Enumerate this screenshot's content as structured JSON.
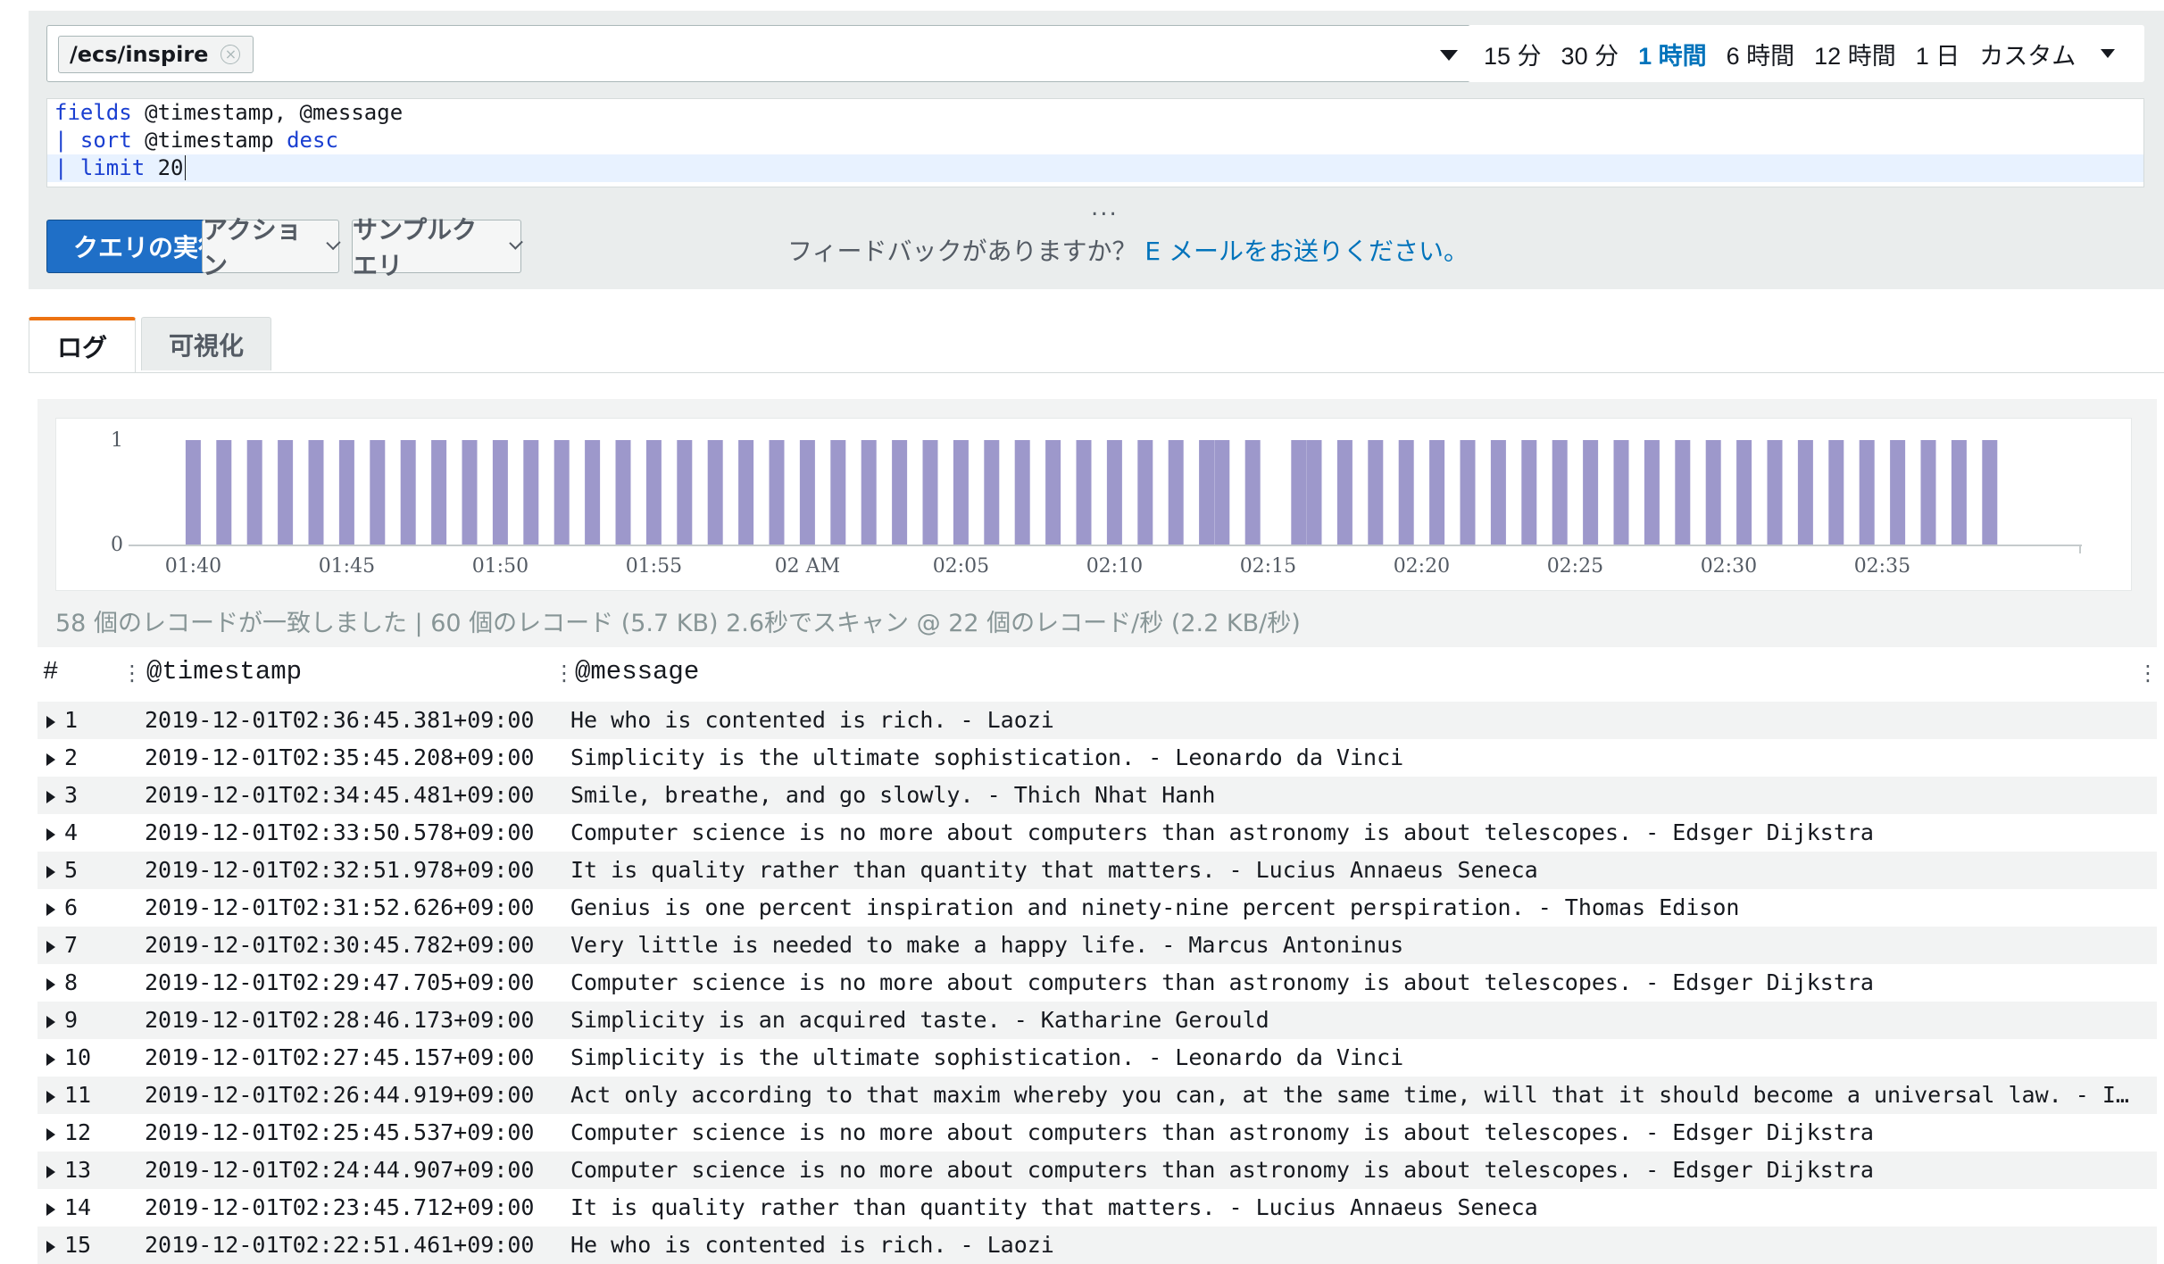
{
  "query_bar": {
    "log_group": "/ecs/inspire",
    "time_options": [
      {
        "label": "15 分",
        "active": false
      },
      {
        "label": "30 分",
        "active": false
      },
      {
        "label": "1 時間",
        "active": true
      },
      {
        "label": "6 時間",
        "active": false
      },
      {
        "label": "12 時間",
        "active": false
      },
      {
        "label": "1 日",
        "active": false
      },
      {
        "label": "カスタム",
        "active": false
      }
    ]
  },
  "editor": {
    "line1_kw": "fields",
    "line1_rest": " @timestamp, @message",
    "line2_pipe": "| ",
    "line2_kw": "sort",
    "line2_mid": " @timestamp ",
    "line2_kw2": "desc",
    "line3_pipe": "| ",
    "line3_kw": "limit",
    "line3_rest": " 20",
    "resize_handle": "..."
  },
  "actions": {
    "run_label": "クエリの実行",
    "actions_label": "アクション",
    "sample_label": "サンプルクエリ",
    "feedback_text": "フィードバックがありますか？",
    "feedback_link": "E メールをお送りください。"
  },
  "tabs": {
    "logs": "ログ",
    "visualization": "可視化"
  },
  "chart_data": {
    "type": "bar",
    "y_ticks": [
      "0",
      "1"
    ],
    "ylim": [
      0,
      1
    ],
    "x_tick_labels": [
      "01:40",
      "01:45",
      "01:50",
      "01:55",
      "02 AM",
      "02:05",
      "02:10",
      "02:15",
      "02:20",
      "02:25",
      "02:30",
      "02:35"
    ],
    "x_range_minutes": [
      -1.0,
      61.5
    ],
    "bar_color": "#9d98cb",
    "bars": [
      {
        "minute": 0.0,
        "value": 1
      },
      {
        "minute": 1.0,
        "value": 1
      },
      {
        "minute": 2.0,
        "value": 1
      },
      {
        "minute": 3.0,
        "value": 1
      },
      {
        "minute": 4.0,
        "value": 1
      },
      {
        "minute": 5.0,
        "value": 1
      },
      {
        "minute": 6.0,
        "value": 1
      },
      {
        "minute": 7.0,
        "value": 1
      },
      {
        "minute": 8.0,
        "value": 1
      },
      {
        "minute": 9.0,
        "value": 1
      },
      {
        "minute": 10.0,
        "value": 1
      },
      {
        "minute": 11.0,
        "value": 1
      },
      {
        "minute": 12.0,
        "value": 1
      },
      {
        "minute": 13.0,
        "value": 1
      },
      {
        "minute": 14.0,
        "value": 1
      },
      {
        "minute": 15.0,
        "value": 1
      },
      {
        "minute": 16.0,
        "value": 1
      },
      {
        "minute": 17.0,
        "value": 1
      },
      {
        "minute": 18.0,
        "value": 1
      },
      {
        "minute": 19.0,
        "value": 1
      },
      {
        "minute": 20.0,
        "value": 1
      },
      {
        "minute": 21.0,
        "value": 1
      },
      {
        "minute": 22.0,
        "value": 1
      },
      {
        "minute": 23.0,
        "value": 1
      },
      {
        "minute": 24.0,
        "value": 1
      },
      {
        "minute": 25.0,
        "value": 1
      },
      {
        "minute": 26.0,
        "value": 1
      },
      {
        "minute": 27.0,
        "value": 1
      },
      {
        "minute": 28.0,
        "value": 1
      },
      {
        "minute": 29.0,
        "value": 1
      },
      {
        "minute": 30.0,
        "value": 1
      },
      {
        "minute": 31.0,
        "value": 1
      },
      {
        "minute": 32.0,
        "value": 1
      },
      {
        "minute": 33.0,
        "value": 1
      },
      {
        "minute": 33.5,
        "value": 1
      },
      {
        "minute": 34.5,
        "value": 1
      },
      {
        "minute": 36.0,
        "value": 1
      },
      {
        "minute": 36.5,
        "value": 1
      },
      {
        "minute": 37.5,
        "value": 1
      },
      {
        "minute": 38.5,
        "value": 1
      },
      {
        "minute": 39.5,
        "value": 1
      },
      {
        "minute": 40.5,
        "value": 1
      },
      {
        "minute": 41.5,
        "value": 1
      },
      {
        "minute": 42.5,
        "value": 1
      },
      {
        "minute": 43.5,
        "value": 1
      },
      {
        "minute": 44.5,
        "value": 1
      },
      {
        "minute": 45.5,
        "value": 1
      },
      {
        "minute": 46.5,
        "value": 1
      },
      {
        "minute": 47.5,
        "value": 1
      },
      {
        "minute": 48.5,
        "value": 1
      },
      {
        "minute": 49.5,
        "value": 1
      },
      {
        "minute": 50.5,
        "value": 1
      },
      {
        "minute": 51.5,
        "value": 1
      },
      {
        "minute": 52.5,
        "value": 1
      },
      {
        "minute": 53.5,
        "value": 1
      },
      {
        "minute": 54.5,
        "value": 1
      },
      {
        "minute": 55.5,
        "value": 1
      },
      {
        "minute": 56.5,
        "value": 1
      },
      {
        "minute": 57.5,
        "value": 1
      },
      {
        "minute": 58.5,
        "value": 1
      }
    ]
  },
  "summary": "58 個のレコードが一致しました | 60 個のレコード (5.7 KB) 2.6秒でスキャン @ 22 個のレコード/秒 (2.2 KB/秒)",
  "table": {
    "headers": {
      "index": "#",
      "timestamp": "@timestamp",
      "message": "@message"
    },
    "rows": [
      {
        "n": "1",
        "ts": "2019-12-01T02:36:45.381+09:00",
        "msg": "He who is contented is rich. - Laozi"
      },
      {
        "n": "2",
        "ts": "2019-12-01T02:35:45.208+09:00",
        "msg": "Simplicity is the ultimate sophistication. - Leonardo da Vinci"
      },
      {
        "n": "3",
        "ts": "2019-12-01T02:34:45.481+09:00",
        "msg": "Smile, breathe, and go slowly. - Thich Nhat Hanh"
      },
      {
        "n": "4",
        "ts": "2019-12-01T02:33:50.578+09:00",
        "msg": "Computer science is no more about computers than astronomy is about telescopes. - Edsger Dijkstra"
      },
      {
        "n": "5",
        "ts": "2019-12-01T02:32:51.978+09:00",
        "msg": "It is quality rather than quantity that matters. - Lucius Annaeus Seneca"
      },
      {
        "n": "6",
        "ts": "2019-12-01T02:31:52.626+09:00",
        "msg": "Genius is one percent inspiration and ninety-nine percent perspiration. - Thomas Edison"
      },
      {
        "n": "7",
        "ts": "2019-12-01T02:30:45.782+09:00",
        "msg": "Very little is needed to make a happy life. - Marcus Antoninus"
      },
      {
        "n": "8",
        "ts": "2019-12-01T02:29:47.705+09:00",
        "msg": "Computer science is no more about computers than astronomy is about telescopes. - Edsger Dijkstra"
      },
      {
        "n": "9",
        "ts": "2019-12-01T02:28:46.173+09:00",
        "msg": "Simplicity is an acquired taste. - Katharine Gerould"
      },
      {
        "n": "10",
        "ts": "2019-12-01T02:27:45.157+09:00",
        "msg": "Simplicity is the ultimate sophistication. - Leonardo da Vinci"
      },
      {
        "n": "11",
        "ts": "2019-12-01T02:26:44.919+09:00",
        "msg": "Act only according to that maxim whereby you can, at the same time, will that it should become a universal law. - Immanuel Kant"
      },
      {
        "n": "12",
        "ts": "2019-12-01T02:25:45.537+09:00",
        "msg": "Computer science is no more about computers than astronomy is about telescopes. - Edsger Dijkstra"
      },
      {
        "n": "13",
        "ts": "2019-12-01T02:24:44.907+09:00",
        "msg": "Computer science is no more about computers than astronomy is about telescopes. - Edsger Dijkstra"
      },
      {
        "n": "14",
        "ts": "2019-12-01T02:23:45.712+09:00",
        "msg": "It is quality rather than quantity that matters. - Lucius Annaeus Seneca"
      },
      {
        "n": "15",
        "ts": "2019-12-01T02:22:51.461+09:00",
        "msg": "He who is contented is rich. - Laozi"
      }
    ]
  }
}
